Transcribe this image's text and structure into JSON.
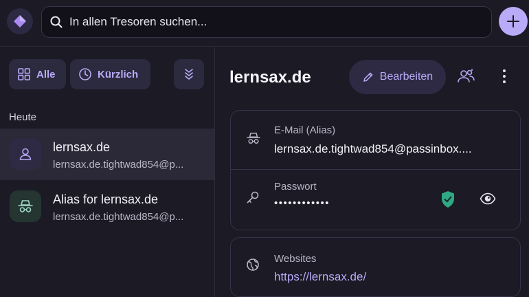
{
  "search": {
    "placeholder": "In allen Tresoren suchen..."
  },
  "filters": {
    "all_label": "Alle",
    "recent_label": "Kürzlich"
  },
  "list": {
    "section_label": "Heute",
    "items": [
      {
        "title": "lernsax.de",
        "subtitle": "lernsax.de.tightwad854@p...",
        "icon": "user-icon",
        "selected": true
      },
      {
        "title": "Alias for lernsax.de",
        "subtitle": "lernsax.de.tightwad854@p...",
        "icon": "alias-icon",
        "selected": false
      }
    ]
  },
  "detail": {
    "title": "lernsax.de",
    "edit_label": "Bearbeiten",
    "email_label": "E-Mail (Alias)",
    "email_value": "lernsax.de.tightwad854@passinbox....",
    "password_label": "Passwort",
    "password_value": "••••••••••••",
    "websites_label": "Websites",
    "website_value": "https://lernsax.de/"
  },
  "colors": {
    "background": "#1b1a25",
    "accent": "#b9abf7",
    "shield_green": "#2fa886"
  }
}
